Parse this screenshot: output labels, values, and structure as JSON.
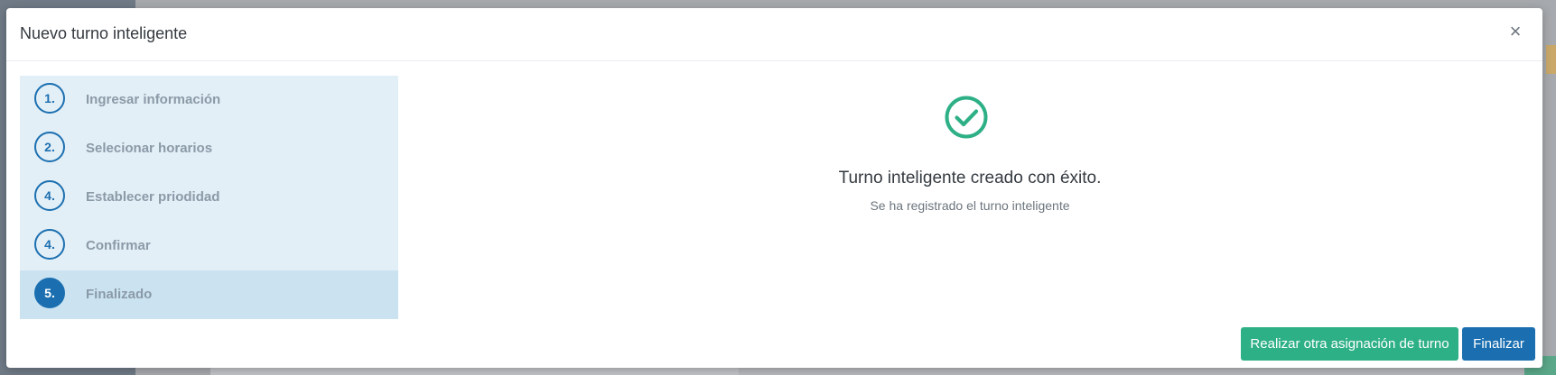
{
  "modal": {
    "title": "Nuevo turno inteligente",
    "close_glyph": "×"
  },
  "steps": [
    {
      "number": "1.",
      "label": "Ingresar información",
      "active": false
    },
    {
      "number": "2.",
      "label": "Selecionar horarios",
      "active": false
    },
    {
      "number": "4.",
      "label": "Establecer priodidad",
      "active": false
    },
    {
      "number": "4.",
      "label": "Confirmar",
      "active": false
    },
    {
      "number": "5.",
      "label": "Finalizado",
      "active": true
    }
  ],
  "result": {
    "icon": "check-circle-icon",
    "title": "Turno inteligente creado con éxito.",
    "subtitle": "Se ha registrado el turno inteligente"
  },
  "footer": {
    "again_label": "Realizar otra asignación de turno",
    "finish_label": "Finalizar"
  },
  "colors": {
    "primary": "#1b6fb0",
    "success": "#2eb086",
    "stepper_bg": "#e3eff7",
    "stepper_active_bg": "#cbe3f1"
  }
}
